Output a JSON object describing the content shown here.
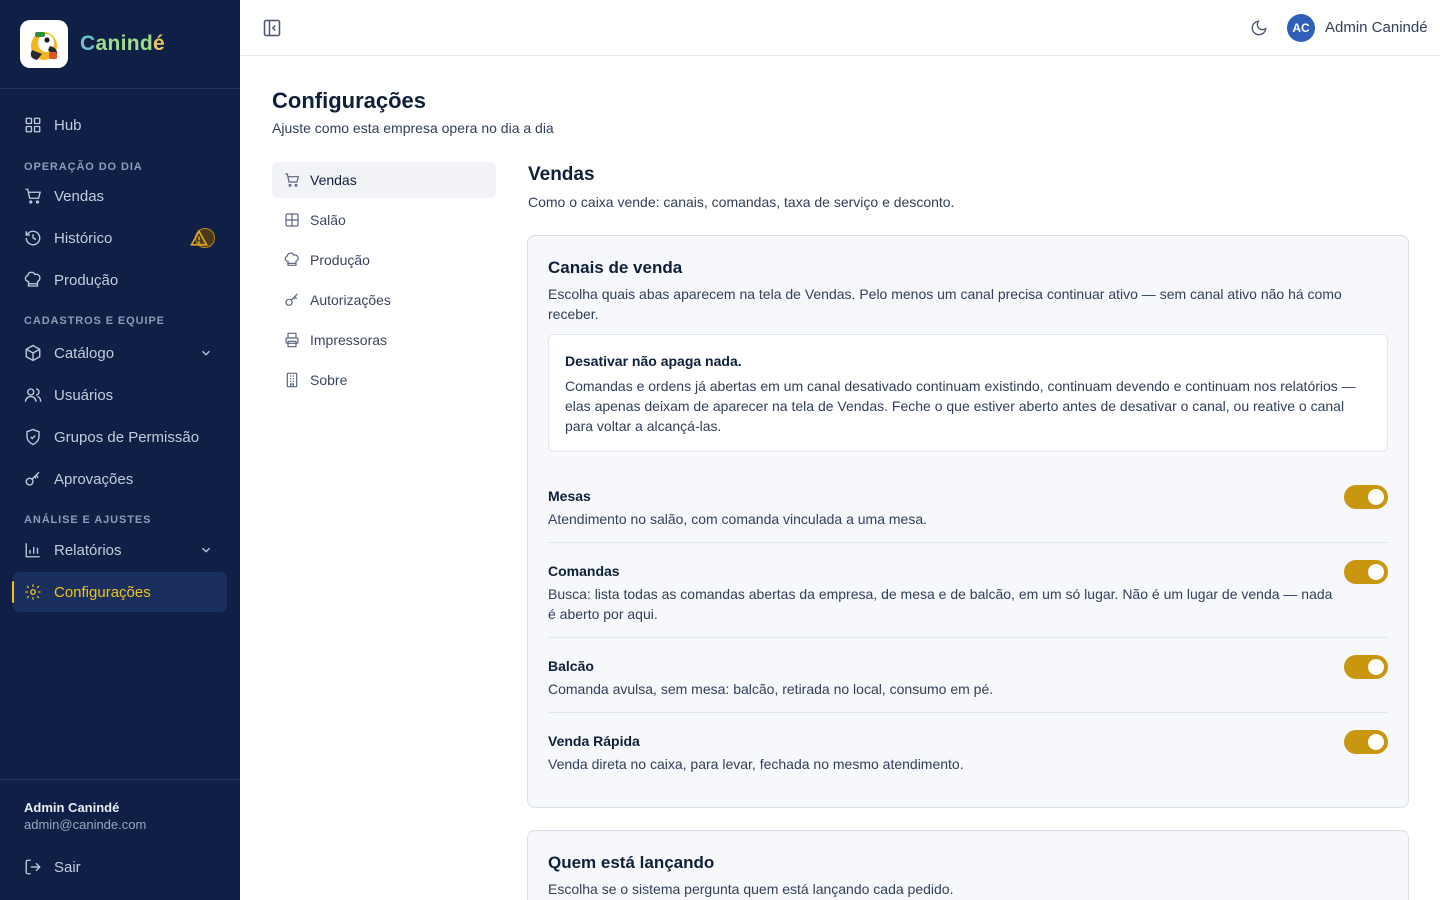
{
  "brand": {
    "name_part1": "C",
    "name_part2": "anind",
    "name_part3": "é"
  },
  "sidebar": {
    "hub": "Hub",
    "section_operacao": "OPERAÇÃO DO DIA",
    "vendas": "Vendas",
    "historico": "Histórico",
    "producao": "Produção",
    "section_cadastros": "CADASTROS E EQUIPE",
    "catalogo": "Catálogo",
    "usuarios": "Usuários",
    "grupos": "Grupos de Permissão",
    "aprovacoes": "Aprovações",
    "section_analise": "ANÁLISE E AJUSTES",
    "relatorios": "Relatórios",
    "configuracoes": "Configurações",
    "user_name": "Admin Canindé",
    "user_email": "admin@caninde.com",
    "logout": "Sair"
  },
  "topbar": {
    "avatar_initials": "AC",
    "user_name": "Admin Canindé"
  },
  "page": {
    "title": "Configurações",
    "subtitle": "Ajuste como esta empresa opera no dia a dia"
  },
  "subnav": {
    "vendas": "Vendas",
    "salao": "Salão",
    "producao": "Produção",
    "autorizacoes": "Autorizações",
    "impressoras": "Impressoras",
    "sobre": "Sobre"
  },
  "section": {
    "title": "Vendas",
    "subtitle": "Como o caixa vende: canais, comandas, taxa de serviço e desconto."
  },
  "canais": {
    "title": "Canais de venda",
    "description": "Escolha quais abas aparecem na tela de Vendas. Pelo menos um canal precisa continuar ativo — sem canal ativo não há como receber.",
    "note_title": "Desativar não apaga nada.",
    "note_body": "Comandas e ordens já abertas em um canal desativado continuam existindo, continuam devendo e continuam nos relatórios — elas apenas deixam de aparecer na tela de Vendas. Feche o que estiver aberto antes de desativar o canal, ou reative o canal para voltar a alcançá-las.",
    "mesas_name": "Mesas",
    "mesas_desc": "Atendimento no salão, com comanda vinculada a uma mesa.",
    "mesas_enabled": true,
    "comandas_name": "Comandas",
    "comandas_desc": "Busca: lista todas as comandas abertas da empresa, de mesa e de balcão, em um só lugar. Não é um lugar de venda — nada é aberto por aqui.",
    "comandas_enabled": true,
    "balcao_name": "Balcão",
    "balcao_desc": "Comanda avulsa, sem mesa: balcão, retirada no local, consumo em pé.",
    "balcao_enabled": true,
    "rapida_name": "Venda Rápida",
    "rapida_desc": "Venda direta no caixa, para levar, fechada no mesmo atendimento.",
    "rapida_enabled": true
  },
  "quem": {
    "title": "Quem está lançando",
    "description": "Escolha se o sistema pergunta quem está lançando cada pedido."
  },
  "colors": {
    "sidebar_bg": "#0f1f45",
    "accent": "#f0c21a",
    "toggle_on": "#c9960f",
    "avatar": "#2f5fb8"
  }
}
